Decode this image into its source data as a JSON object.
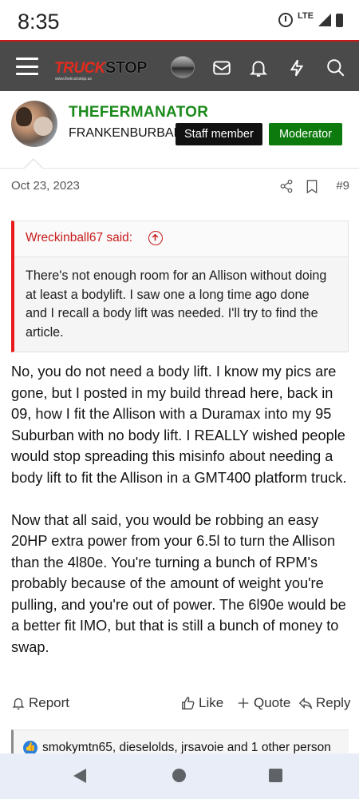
{
  "status_bar": {
    "time": "8:35",
    "network": "LTE"
  },
  "header": {
    "logo_part1": "TRUCK",
    "logo_part2": "STOP",
    "logo_sub": "www.thetruckstop.us",
    "icons": [
      "menu-icon",
      "avatar",
      "inbox-icon",
      "bell-icon",
      "lightning-icon",
      "search-icon"
    ]
  },
  "post": {
    "author": {
      "name": "THEFERMANATOR",
      "title": "FRANKENBURBAN",
      "badges": [
        "Staff member",
        "Moderator"
      ]
    },
    "date": "Oct 23, 2023",
    "number": "#9",
    "quote": {
      "author": "Wreckinball67 said:",
      "text": "There's not enough room for an Allison without doing at least a bodylift. I saw one a long time ago done and I recall a body lift was needed. I'll try to find the article."
    },
    "paragraphs": [
      "No, you do not need a body lift. I know my pics are gone, but I posted in my build thread here, back in 09, how I fit the Allison with a Duramax into my 95 Suburban with no body lift. I REALLY wished people would stop spreading this misinfo about needing a body lift to fit the Allison in a GMT400 platform truck.",
      "Now that all said, you would be robbing an easy 20HP extra power from your 6.5l to turn the Allison than the 4l80e. You're turning a bunch of RPM's probably because of the amount of weight you're pulling, and you're out of power. The 6l90e would be a better fit IMO, but that is still a bunch of money to swap."
    ],
    "actions": {
      "report": "Report",
      "like": "Like",
      "quote": "Quote",
      "reply": "Reply"
    },
    "reactions": "smokymtn65, dieselolds, jrsavoie and 1 other person"
  },
  "colors": {
    "header_bg": "#4a4a4a",
    "author_green": "#1a8a1a",
    "moderator_green": "#0c7a0c",
    "quote_red": "#c91a1a"
  }
}
